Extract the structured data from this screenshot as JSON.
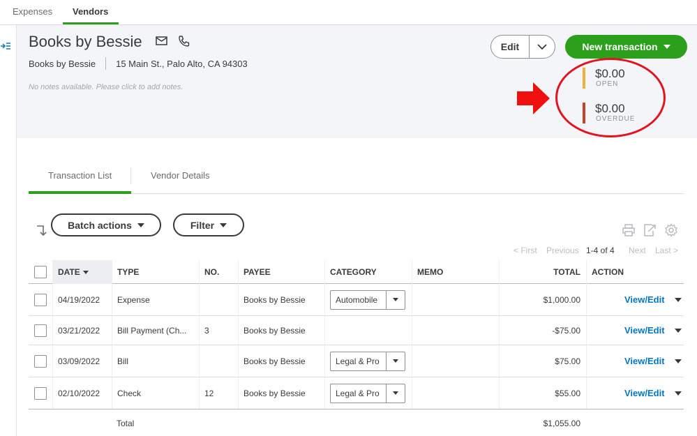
{
  "top_tabs": [
    "Expenses",
    "Vendors"
  ],
  "vendor": {
    "name": "Books by Bessie",
    "display_name": "Books by Bessie",
    "address": "15 Main St., Palo Alto, CA 94303",
    "notes_placeholder": "No notes available. Please click to add notes."
  },
  "actions": {
    "edit_label": "Edit",
    "new_transaction_label": "New transaction"
  },
  "summary": {
    "open_amount": "$0.00",
    "open_label": "OPEN",
    "overdue_amount": "$0.00",
    "overdue_label": "OVERDUE"
  },
  "colors": {
    "brand_green": "#2ca01c",
    "link_blue": "#0077c5",
    "open_bar": "#f2b134",
    "overdue_bar": "#c9412b",
    "annotation_red": "#e0151d"
  },
  "subtabs": [
    "Transaction List",
    "Vendor Details"
  ],
  "toolbar": {
    "batch_actions_label": "Batch actions",
    "filter_label": "Filter",
    "icons": [
      "sort-icon",
      "print-icon",
      "export-icon",
      "settings-icon"
    ]
  },
  "pager": {
    "first": "< First",
    "previous": "Previous",
    "range": "1-4 of 4",
    "next": "Next",
    "last": "Last >"
  },
  "table": {
    "columns": [
      "DATE",
      "TYPE",
      "NO.",
      "PAYEE",
      "CATEGORY",
      "MEMO",
      "TOTAL",
      "ACTION"
    ],
    "rows": [
      {
        "date": "04/19/2022",
        "type": "Expense",
        "no": "",
        "payee": "Books by Bessie",
        "category": "Automobile",
        "memo": "",
        "total": "$1,000.00",
        "action": "View/Edit"
      },
      {
        "date": "03/21/2022",
        "type": "Bill Payment (Ch...",
        "no": "3",
        "payee": "Books by Bessie",
        "category": "",
        "memo": "",
        "total": "-$75.00",
        "action": "View/Edit"
      },
      {
        "date": "03/09/2022",
        "type": "Bill",
        "no": "",
        "payee": "Books by Bessie",
        "category": "Legal & Pro",
        "memo": "",
        "total": "$75.00",
        "action": "View/Edit"
      },
      {
        "date": "02/10/2022",
        "type": "Check",
        "no": "12",
        "payee": "Books by Bessie",
        "category": "Legal & Pro",
        "memo": "",
        "total": "$55.00",
        "action": "View/Edit"
      }
    ],
    "total_label": "Total",
    "total_value": "$1,055.00"
  }
}
